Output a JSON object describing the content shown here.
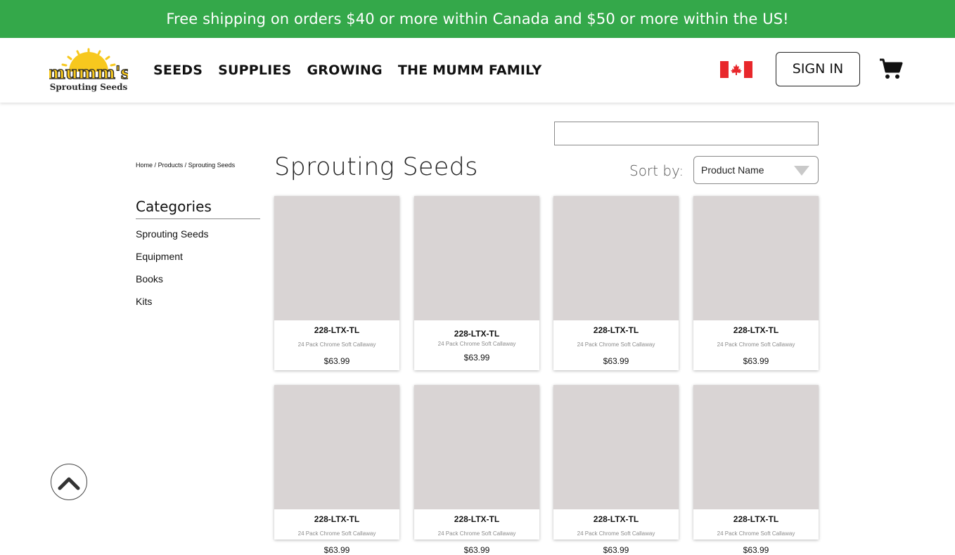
{
  "promo": {
    "text": "Free shipping on orders $40 or more within Canada and $50 or more within the US!"
  },
  "colors": {
    "promo_bg": "#34a84a",
    "card_image_bg": "#d9d4d4",
    "flag_red": "#e8272b"
  },
  "header": {
    "logo": {
      "line1": "mumm's",
      "line2": "Sprouting Seeds"
    },
    "nav": [
      {
        "label": "SEEDS"
      },
      {
        "label": "SUPPLIES"
      },
      {
        "label": "GROWING"
      },
      {
        "label": "THE MUMM FAMILY"
      }
    ],
    "country_flag_icon": "canada-flag-icon",
    "sign_in_label": "SIGN IN",
    "cart_icon": "shopping-cart-icon"
  },
  "search": {
    "value": "",
    "placeholder": ""
  },
  "breadcrumb": {
    "home": "Home",
    "sep": "/",
    "products": "Products",
    "current": "Sprouting Seeds"
  },
  "page_title": "Sprouting Seeds",
  "sort": {
    "label": "Sort by:",
    "selected": "Product Name"
  },
  "categories": {
    "heading": "Categories",
    "items": [
      {
        "label": "Sprouting Seeds"
      },
      {
        "label": "Equipment"
      },
      {
        "label": "Books"
      },
      {
        "label": "Kits"
      }
    ]
  },
  "products": [
    {
      "sku": "228-LTX-TL",
      "description": "24 Pack Chrome Soft Callaway",
      "price": "$63.99"
    },
    {
      "sku": "228-LTX-TL",
      "description": "24 Pack Chrome Soft Callaway",
      "price": "$63.99"
    },
    {
      "sku": "228-LTX-TL",
      "description": "24 Pack Chrome Soft Callaway",
      "price": "$63.99"
    },
    {
      "sku": "228-LTX-TL",
      "description": "24 Pack Chrome Soft Callaway",
      "price": "$63.99"
    },
    {
      "sku": "228-LTX-TL",
      "description": "24 Pack Chrome Soft Callaway",
      "price": "$63.99"
    },
    {
      "sku": "228-LTX-TL",
      "description": "24 Pack Chrome Soft Callaway",
      "price": "$63.99"
    },
    {
      "sku": "228-LTX-TL",
      "description": "24 Pack Chrome Soft Callaway",
      "price": "$63.99"
    },
    {
      "sku": "228-LTX-TL",
      "description": "24 Pack Chrome Soft Callaway",
      "price": "$63.99"
    }
  ],
  "back_to_top_icon": "chevron-up-icon"
}
